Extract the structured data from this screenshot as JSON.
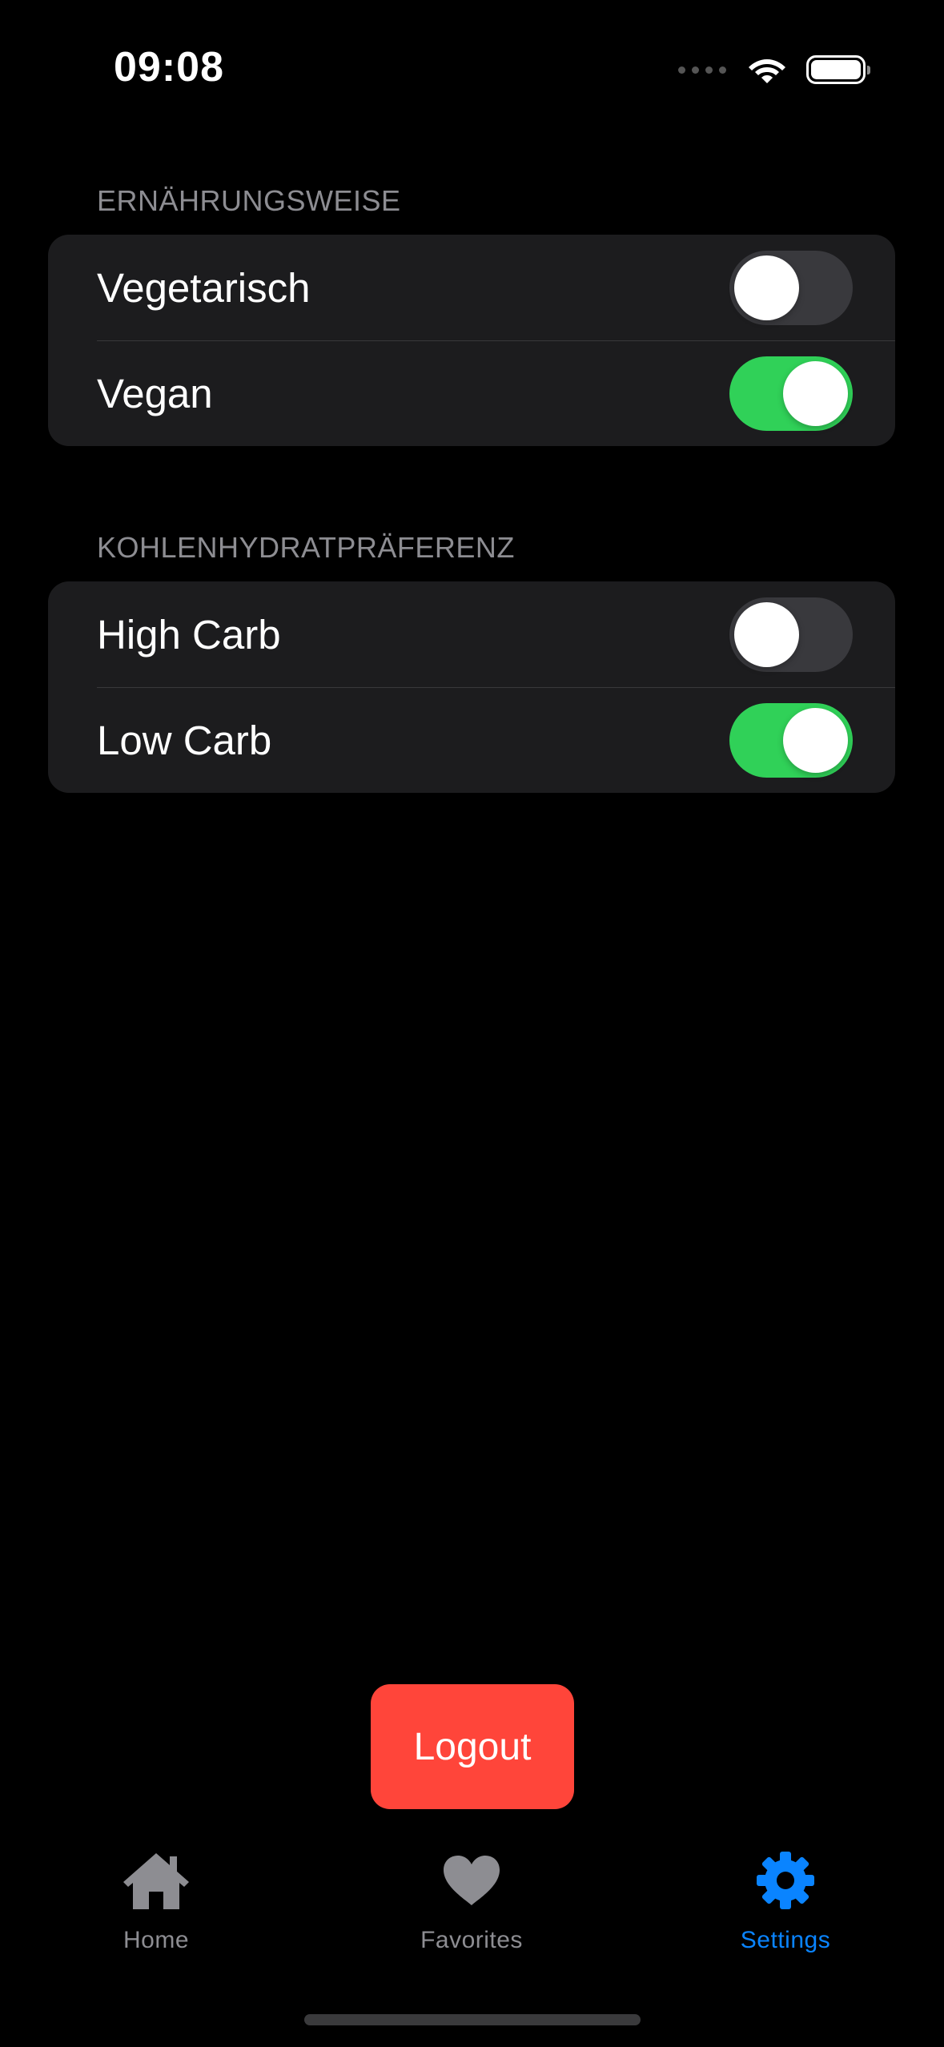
{
  "status_bar": {
    "time": "09:08",
    "icons": [
      "cellular-signal-icon",
      "wifi-icon",
      "battery-icon"
    ]
  },
  "sections": [
    {
      "header": "ERNÄHRUNGSWEISE",
      "rows": [
        {
          "label": "Vegetarisch",
          "on": false
        },
        {
          "label": "Vegan",
          "on": true
        }
      ]
    },
    {
      "header": "KOHLENHYDRATPRÄFERENZ",
      "rows": [
        {
          "label": "High Carb",
          "on": false
        },
        {
          "label": "Low Carb",
          "on": true
        }
      ]
    }
  ],
  "logout_label": "Logout",
  "tab_bar": {
    "tabs": [
      {
        "label": "Home",
        "icon": "house-icon",
        "active": false
      },
      {
        "label": "Favorites",
        "icon": "heart-icon",
        "active": false
      },
      {
        "label": "Settings",
        "icon": "gear-icon",
        "active": true
      }
    ]
  },
  "colors": {
    "background": "#000000",
    "group_background": "#1c1c1e",
    "toggle_on": "#30d158",
    "toggle_off": "#39393d",
    "logout": "#ff453a",
    "tab_active": "#0a84ff",
    "tab_inactive": "#8d8d92",
    "section_header": "#8d8d92"
  }
}
